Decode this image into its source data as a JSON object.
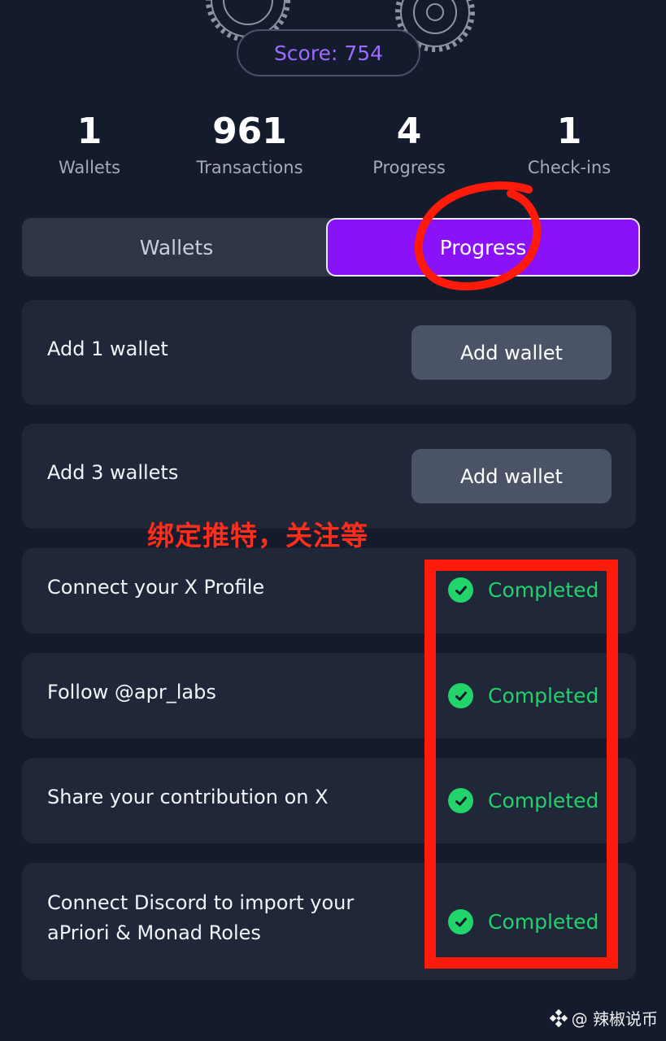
{
  "score": {
    "label": "Score: 754"
  },
  "stats": [
    {
      "value": "1",
      "label": "Wallets"
    },
    {
      "value": "961",
      "label": "Transactions"
    },
    {
      "value": "4",
      "label": "Progress"
    },
    {
      "value": "1",
      "label": "Check-ins"
    }
  ],
  "tabs": {
    "wallets": "Wallets",
    "progress": "Progress",
    "active": "progress"
  },
  "tasks": [
    {
      "label": "Add 1 wallet",
      "action": "Add wallet"
    },
    {
      "label": "Add 3 wallets",
      "action": "Add wallet"
    },
    {
      "label": "Connect your X Profile",
      "status": "Completed"
    },
    {
      "label": "Follow @apr_labs",
      "status": "Completed"
    },
    {
      "label": "Share your contribution on X",
      "status": "Completed"
    },
    {
      "label_line1": "Connect Discord to import your",
      "label_line2": "aPriori & Monad Roles",
      "status": "Completed"
    }
  ],
  "annotation": {
    "text": "绑定推特，关注等",
    "color": "#ff2d1a"
  },
  "watermark": {
    "text": "@ 辣椒说币"
  },
  "colors": {
    "accent": "#8a12f8",
    "success": "#22d46a",
    "score": "#9b6cff",
    "annotation": "#ff1a0a"
  }
}
